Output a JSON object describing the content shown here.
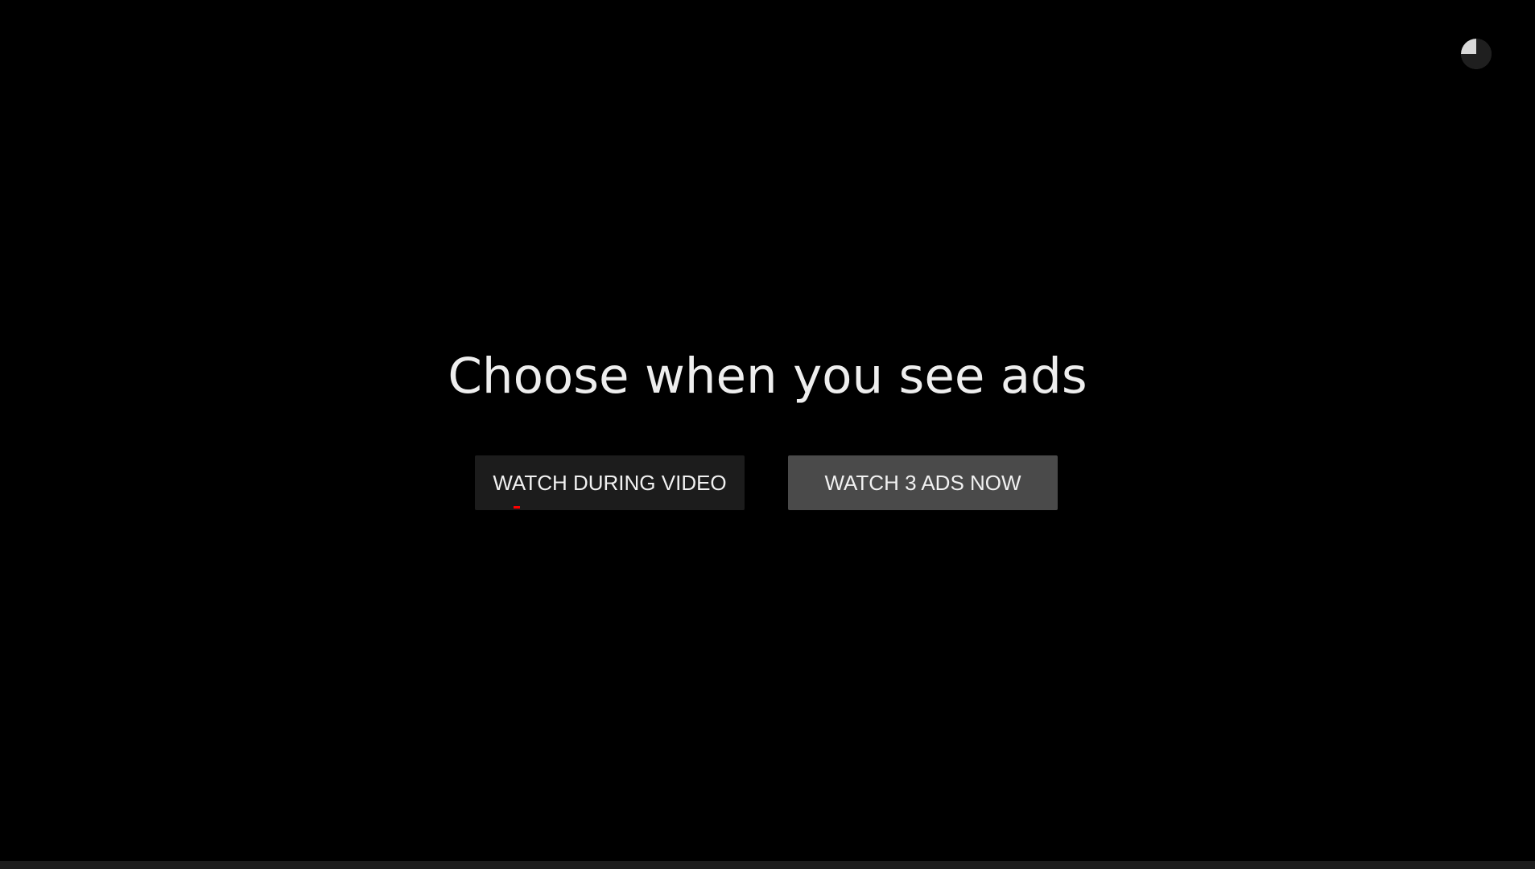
{
  "prompt": {
    "title": "Choose when you see ads"
  },
  "buttons": {
    "watch_during_video": "WATCH DURING VIDEO",
    "watch_now": "WATCH 3 ADS NOW"
  },
  "timer": {
    "icon": "countdown-pie-icon",
    "elapsed_fraction": 0.25
  },
  "colors": {
    "background": "#000000",
    "button_secondary": "#1c1c1c",
    "button_primary": "#4a4a4a",
    "ad_marker": "#ff0000",
    "text": "#eeeeee"
  }
}
